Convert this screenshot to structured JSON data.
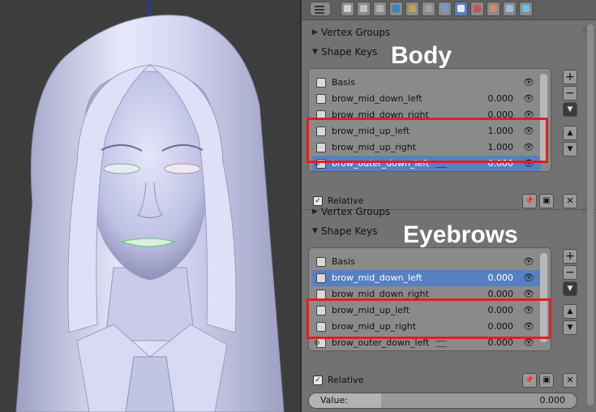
{
  "toolbar": {
    "icons": [
      "render-icon",
      "render-layers-icon",
      "scene-icon",
      "world-icon",
      "object-icon",
      "constraints-icon",
      "modifiers-icon",
      "data-icon",
      "material-icon",
      "texture-icon",
      "particles-icon",
      "physics-icon"
    ],
    "active": "data-icon"
  },
  "panels": [
    {
      "vertex_groups_title": "Vertex Groups",
      "shape_keys_title": "Shape Keys",
      "annotation": "Body",
      "keys": [
        {
          "name": "Basis",
          "value": "",
          "selected": false
        },
        {
          "name": "brow_mid_down_left",
          "value": "0.000",
          "selected": false
        },
        {
          "name": "brow_mid_down_right",
          "value": "0.000",
          "selected": false
        },
        {
          "name": "brow_mid_up_left",
          "value": "1.000",
          "selected": false
        },
        {
          "name": "brow_mid_up_right",
          "value": "1.000",
          "selected": false
        },
        {
          "name": "brow_outer_down_left",
          "value": "0.000",
          "selected": true
        }
      ],
      "relative_label": "Relative",
      "relative_checked": true
    },
    {
      "vertex_groups_title": "Vertex Groups",
      "shape_keys_title": "Shape Keys",
      "annotation": "Eyebrows",
      "keys": [
        {
          "name": "Basis",
          "value": "",
          "selected": false
        },
        {
          "name": "brow_mid_down_left",
          "value": "0.000",
          "selected": true
        },
        {
          "name": "brow_mid_down_right",
          "value": "0.000",
          "selected": false
        },
        {
          "name": "brow_mid_up_left",
          "value": "0.000",
          "selected": false
        },
        {
          "name": "brow_mid_up_right",
          "value": "0.000",
          "selected": false
        },
        {
          "name": "brow_outer_down_left",
          "value": "0.000",
          "selected": false
        }
      ],
      "relative_label": "Relative",
      "relative_checked": true
    }
  ],
  "value_field": {
    "label": "Value:",
    "value": "0.000",
    "fraction": 0.27
  },
  "colors": {
    "selection": "#5680c2",
    "annotation_box": "#e02020",
    "panel_bg": "#727272",
    "mesh": "#cfd0f0"
  }
}
